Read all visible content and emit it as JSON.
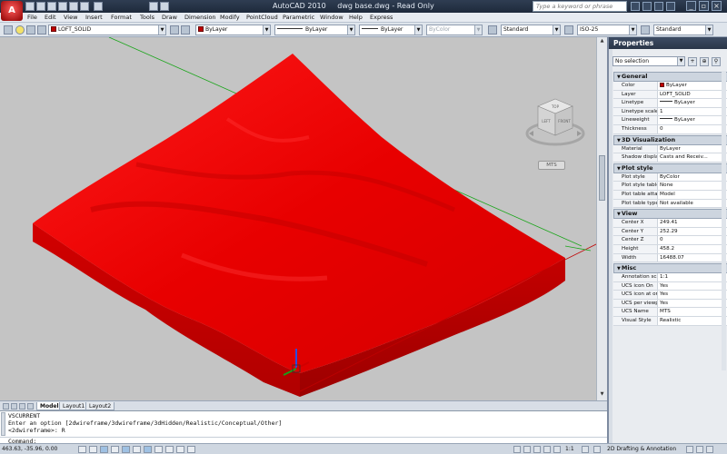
{
  "window": {
    "app_name": "AutoCAD 2010",
    "document": "dwg base.dwg - Read Only",
    "search_placeholder": "Type a keyword or phrase"
  },
  "menu": [
    "File",
    "Edit",
    "View",
    "Insert",
    "Format",
    "Tools",
    "Draw",
    "Dimension",
    "Modify",
    "PointCloud",
    "Parametric",
    "Window",
    "Help",
    "Express"
  ],
  "toolbar": {
    "layer": "LOFT_SOLID",
    "color": "ByLayer",
    "linetype": "ByLayer",
    "lineweight": "ByLayer",
    "plotstyle": "ByColor",
    "text_style": "Standard",
    "dim_style": "ISO-25",
    "table_style": "Standard"
  },
  "viewport": {
    "mts_label": "MTS",
    "viewcube_faces": [
      "TOP",
      "LEFT",
      "FRONT"
    ],
    "solid_color": "#e00000"
  },
  "tabs": [
    "Model",
    "Layout1",
    "Layout2"
  ],
  "command": {
    "lines": [
      "VSCURRENT",
      "Enter an option [2dwireframe/3dwireframe/3dHidden/Realistic/Conceptual/Other]",
      "<2dwireframe>: R"
    ],
    "prompt": "Command:"
  },
  "status": {
    "coords": "463.63, -35.96, 0.00",
    "annotation_scale": "1:1",
    "workspace": "2D Drafting & Annotation"
  },
  "properties": {
    "title": "Properties",
    "selection": "No selection",
    "sections": [
      {
        "name": "General",
        "rows": [
          {
            "key": "Color",
            "value": "ByLayer",
            "kind": "swatch"
          },
          {
            "key": "Layer",
            "value": "LOFT_SOLID"
          },
          {
            "key": "Linetype",
            "value": "ByLayer",
            "kind": "line"
          },
          {
            "key": "Linetype scale",
            "value": "1"
          },
          {
            "key": "Lineweight",
            "value": "ByLayer",
            "kind": "line"
          },
          {
            "key": "Thickness",
            "value": "0"
          }
        ]
      },
      {
        "name": "3D Visualization",
        "rows": [
          {
            "key": "Material",
            "value": "ByLayer"
          },
          {
            "key": "Shadow display",
            "value": "Casts and Receiv..."
          }
        ]
      },
      {
        "name": "Plot style",
        "rows": [
          {
            "key": "Plot style",
            "value": "ByColor"
          },
          {
            "key": "Plot style table",
            "value": "None"
          },
          {
            "key": "Plot table attac...",
            "value": "Model"
          },
          {
            "key": "Plot table type",
            "value": "Not available"
          }
        ]
      },
      {
        "name": "View",
        "rows": [
          {
            "key": "Center X",
            "value": "249.41"
          },
          {
            "key": "Center Y",
            "value": "252.29"
          },
          {
            "key": "Center Z",
            "value": "0"
          },
          {
            "key": "Height",
            "value": "458.2"
          },
          {
            "key": "Width",
            "value": "16488.07"
          }
        ]
      },
      {
        "name": "Misc",
        "rows": [
          {
            "key": "Annotation scale",
            "value": "1:1"
          },
          {
            "key": "UCS icon On",
            "value": "Yes"
          },
          {
            "key": "UCS icon at origin",
            "value": "Yes"
          },
          {
            "key": "UCS per viewport",
            "value": "Yes"
          },
          {
            "key": "UCS Name",
            "value": "MTS"
          },
          {
            "key": "Visual Style",
            "value": "Realistic"
          }
        ]
      }
    ]
  }
}
